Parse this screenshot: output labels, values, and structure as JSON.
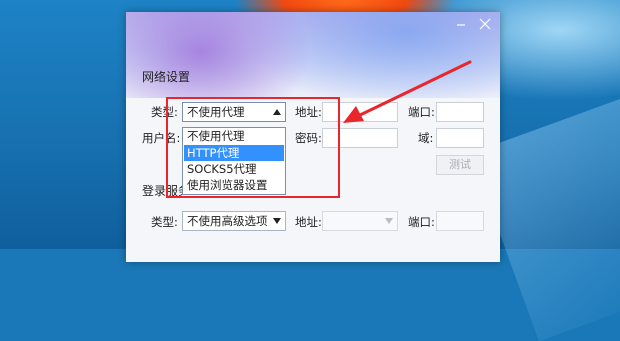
{
  "network_settings": {
    "title": "网络设置",
    "type_label": "类型:",
    "type_value": "不使用代理",
    "address_label": "地址:",
    "port_label": "端口:",
    "username_label": "用户名:",
    "password_label": "密码:",
    "domain_label": "域:",
    "test_button": "测试",
    "proxy_options": [
      "不使用代理",
      "HTTP代理",
      "SOCKS5代理",
      "使用浏览器设置"
    ],
    "highlighted_option": "HTTP代理"
  },
  "login_server": {
    "title_visible": "登录服务",
    "type_label": "类型:",
    "type_value": "不使用高级选项",
    "address_label": "地址:",
    "port_label": "端口:"
  },
  "colors": {
    "annotation_red": "#e8262c",
    "selection_blue": "#3390ff"
  },
  "icons": {
    "minimize": "minimize-icon",
    "close": "close-icon",
    "dropdown_open": "chevron-up-icon",
    "dropdown_closed": "chevron-down-icon"
  }
}
